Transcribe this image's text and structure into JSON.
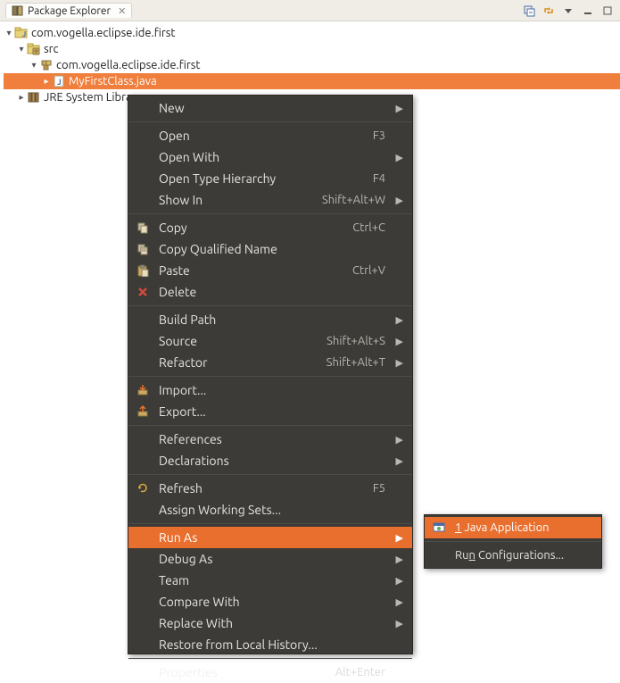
{
  "view": {
    "title": "Package Explorer"
  },
  "tree": {
    "project": "com.vogella.eclipse.ide.first",
    "src": "src",
    "package": "com.vogella.eclipse.ide.first",
    "file": "MyFirstClass.java",
    "jre": "JRE System Library"
  },
  "menu": {
    "new": "New",
    "open": "Open",
    "open_shortcut": "F3",
    "open_with": "Open With",
    "open_type_hierarchy": "Open Type Hierarchy",
    "open_type_hierarchy_shortcut": "F4",
    "show_in": "Show In",
    "show_in_shortcut": "Shift+Alt+W",
    "copy": "Copy",
    "copy_shortcut": "Ctrl+C",
    "copy_qualified_name": "Copy Qualified Name",
    "paste": "Paste",
    "paste_shortcut": "Ctrl+V",
    "delete": "Delete",
    "build_path": "Build Path",
    "source": "Source",
    "source_shortcut": "Shift+Alt+S",
    "refactor": "Refactor",
    "refactor_shortcut": "Shift+Alt+T",
    "import": "Import...",
    "export": "Export...",
    "references": "References",
    "declarations": "Declarations",
    "refresh": "Refresh",
    "refresh_shortcut": "F5",
    "assign_working_sets": "Assign Working Sets...",
    "run_as": "Run As",
    "debug_as": "Debug As",
    "team": "Team",
    "compare_with": "Compare With",
    "replace_with": "Replace With",
    "restore_from_local_history": "Restore from Local History...",
    "properties": "Properties",
    "properties_shortcut": "Alt+Enter"
  },
  "submenu": {
    "java_application_prefix": "1",
    "java_application": "Java Application",
    "run_configurations": "Configurations..."
  }
}
